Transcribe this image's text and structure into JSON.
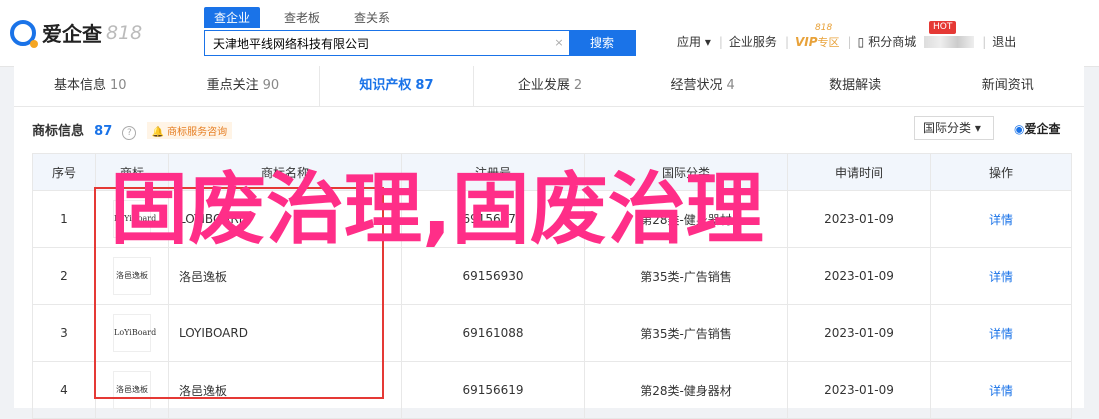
{
  "logo": {
    "text": "爱企查",
    "num": "818"
  },
  "search": {
    "tabs": [
      "查企业",
      "查老板",
      "查关系"
    ],
    "value": "天津地平线网络科技有限公司",
    "clear": "×",
    "button": "搜索"
  },
  "nav": {
    "app": "应用",
    "app_caret": "▾",
    "service": "企业服务",
    "vip": "VIP",
    "vip_sub": "专区",
    "vip_tag": "818",
    "points": "积分商城",
    "hot": "HOT",
    "logout": "退出"
  },
  "tabs": [
    {
      "label": "基本信息",
      "count": "10"
    },
    {
      "label": "重点关注",
      "count": "90"
    },
    {
      "label": "知识产权",
      "count": "87"
    },
    {
      "label": "企业发展",
      "count": "2"
    },
    {
      "label": "经营状况",
      "count": "4"
    },
    {
      "label": "数据解读",
      "count": ""
    },
    {
      "label": "新闻资讯",
      "count": ""
    }
  ],
  "section": {
    "title": "商标信息",
    "count": "87",
    "help": "?",
    "consult": "商标服务咨询",
    "filter": "国际分类 ▾",
    "brand": "爱企查"
  },
  "table": {
    "headers": [
      "序号",
      "商标",
      "商标名称",
      "注册号",
      "国际分类",
      "申请时间",
      "操作"
    ],
    "rows": [
      {
        "idx": "1",
        "img": "LoYiBoard",
        "name": "LOYIBOARD",
        "reg": "69156879",
        "cls": "第28类-健身器材",
        "date": "2023-01-09",
        "op": "详情"
      },
      {
        "idx": "2",
        "img": "洛邑逸板",
        "name": "洛邑逸板",
        "reg": "69156930",
        "cls": "第35类-广告销售",
        "date": "2023-01-09",
        "op": "详情"
      },
      {
        "idx": "3",
        "img": "LoYiBoard",
        "name": "LOYIBOARD",
        "reg": "69161088",
        "cls": "第35类-广告销售",
        "date": "2023-01-09",
        "op": "详情"
      },
      {
        "idx": "4",
        "img": "洛邑逸板",
        "name": "洛邑逸板",
        "reg": "69156619",
        "cls": "第28类-健身器材",
        "date": "2023-01-09",
        "op": "详情"
      }
    ]
  },
  "overlay": {
    "text": "固废治理,固废治理"
  }
}
